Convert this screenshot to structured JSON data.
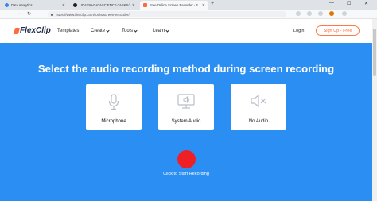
{
  "browser": {
    "tabs": [
      {
        "title": "Data Analytics",
        "favicon_color": "#3b82f6"
      },
      {
        "title": "UDAY99-DATASCIENCE-TASKS/",
        "favicon_color": "#222222"
      },
      {
        "title": "Free Online Screen Recorder - F",
        "favicon_color": "#ff6b3d"
      }
    ],
    "new_tab_symbol": "+",
    "window_controls": {
      "minimize": "—",
      "maximize": "☐",
      "close": "✕"
    },
    "nav": {
      "back": "←",
      "forward": "→",
      "reload": "↻"
    },
    "url": "https://www.flexclip.com/tools/screen-recorder/"
  },
  "header": {
    "logo_text": "FlexClip",
    "nav": {
      "templates": "Templates",
      "create": "Create",
      "tools": "Tools",
      "learn": "Learn"
    },
    "login": "Login",
    "signup": "Sign Up - Free"
  },
  "main": {
    "headline": "Select the audio recording method during screen recording",
    "options": [
      {
        "label": "Microphone",
        "icon": "microphone-icon"
      },
      {
        "label": "System Audio",
        "icon": "system-audio-icon"
      },
      {
        "label": "No Audio",
        "icon": "muted-speaker-icon"
      }
    ],
    "record_label": "Click to Start Recording"
  },
  "colors": {
    "brand_blue": "#2b8ef3",
    "accent_orange": "#ff6b3d",
    "record_red": "#ee1f25"
  }
}
